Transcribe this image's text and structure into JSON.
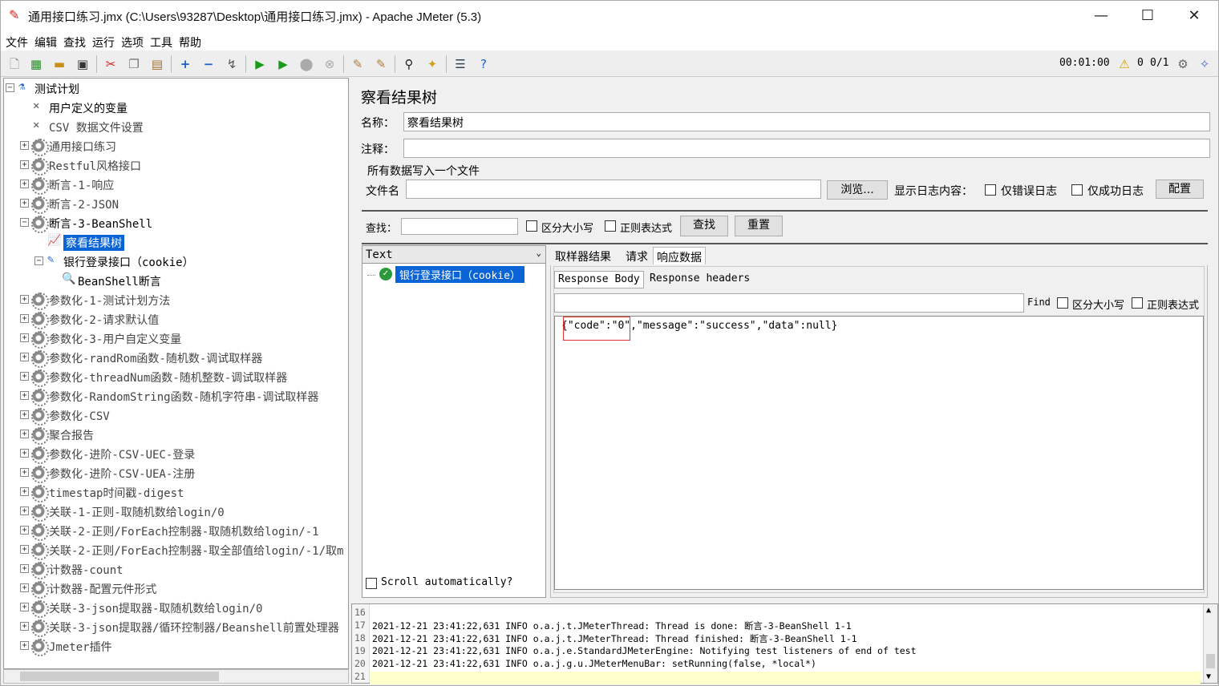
{
  "window": {
    "title": "通用接口练习.jmx (C:\\Users\\93287\\Desktop\\通用接口练习.jmx) - Apache JMeter (5.3)",
    "minimize": "—",
    "maximize": "☐",
    "close": "✕"
  },
  "menu": [
    "文件",
    "编辑",
    "查找",
    "运行",
    "选项",
    "工具",
    "帮助"
  ],
  "toolbar_status": {
    "elapsed": "00:01:00",
    "warnings": "0",
    "threads": "0/1"
  },
  "tree": [
    {
      "label": "测试计划",
      "level": 0,
      "expander": "−",
      "icon": "test-plan-icon"
    },
    {
      "label": "用户定义的变量",
      "level": 1,
      "icon": "wrench-icon"
    },
    {
      "label": "CSV 数据文件设置",
      "level": 1,
      "icon": "wrench-icon"
    },
    {
      "label": "通用接口练习",
      "level": 1,
      "expander": "+",
      "icon": "thread-group-icon"
    },
    {
      "label": "Restful风格接口",
      "level": 1,
      "expander": "+",
      "icon": "thread-group-icon"
    },
    {
      "label": "断言-1-响应",
      "level": 1,
      "expander": "+",
      "icon": "thread-group-icon"
    },
    {
      "label": "断言-2-JSON",
      "level": 1,
      "expander": "+",
      "icon": "thread-group-icon"
    },
    {
      "label": "断言-3-BeanShell",
      "level": 1,
      "expander": "−",
      "icon": "thread-group-icon"
    },
    {
      "label": "察看结果树",
      "level": 2,
      "icon": "results-tree-icon",
      "selected": true
    },
    {
      "label": "银行登录接口（cookie）",
      "level": 2,
      "expander": "−",
      "icon": "sampler-icon"
    },
    {
      "label": "BeanShell断言",
      "level": 3,
      "icon": "assertion-icon"
    },
    {
      "label": "参数化-1-测试计划方法",
      "level": 1,
      "expander": "+",
      "icon": "thread-group-icon"
    },
    {
      "label": "参数化-2-请求默认值",
      "level": 1,
      "expander": "+",
      "icon": "thread-group-icon"
    },
    {
      "label": "参数化-3-用户自定义变量",
      "level": 1,
      "expander": "+",
      "icon": "thread-group-icon"
    },
    {
      "label": "参数化-randRom函数-随机数-调试取样器",
      "level": 1,
      "expander": "+",
      "icon": "thread-group-icon"
    },
    {
      "label": "参数化-threadNum函数-随机整数-调试取样器",
      "level": 1,
      "expander": "+",
      "icon": "thread-group-icon"
    },
    {
      "label": "参数化-RandomString函数-随机字符串-调试取样器",
      "level": 1,
      "expander": "+",
      "icon": "thread-group-icon"
    },
    {
      "label": "参数化-CSV",
      "level": 1,
      "expander": "+",
      "icon": "thread-group-icon"
    },
    {
      "label": "聚合报告",
      "level": 1,
      "expander": "+",
      "icon": "thread-group-icon"
    },
    {
      "label": "参数化-进阶-CSV-UEC-登录",
      "level": 1,
      "expander": "+",
      "icon": "thread-group-icon"
    },
    {
      "label": "参数化-进阶-CSV-UEA-注册",
      "level": 1,
      "expander": "+",
      "icon": "thread-group-icon"
    },
    {
      "label": "timestap时间戳-digest",
      "level": 1,
      "expander": "+",
      "icon": "thread-group-icon"
    },
    {
      "label": "关联-1-正则-取随机数给login/0",
      "level": 1,
      "expander": "+",
      "icon": "thread-group-icon"
    },
    {
      "label": "关联-2-正则/ForEach控制器-取随机数给login/-1",
      "level": 1,
      "expander": "+",
      "icon": "thread-group-icon"
    },
    {
      "label": "关联-2-正则/ForEach控制器-取全部值给login/-1/取m",
      "level": 1,
      "expander": "+",
      "icon": "thread-group-icon"
    },
    {
      "label": "计数器-count",
      "level": 1,
      "expander": "+",
      "icon": "thread-group-icon"
    },
    {
      "label": "计数器-配置元件形式",
      "level": 1,
      "expander": "+",
      "icon": "thread-group-icon"
    },
    {
      "label": "关联-3-json提取器-取随机数给login/0",
      "level": 1,
      "expander": "+",
      "icon": "thread-group-icon"
    },
    {
      "label": "关联-3-json提取器/循环控制器/Beanshell前置处理器",
      "level": 1,
      "expander": "+",
      "icon": "thread-group-icon"
    },
    {
      "label": "Jmeter插件",
      "level": 1,
      "expander": "+",
      "icon": "thread-group-icon"
    }
  ],
  "panel": {
    "title": "察看结果树",
    "name_label": "名称：",
    "name_value": "察看结果树",
    "comment_label": "注释：",
    "comment_value": "",
    "file_section": "所有数据写入一个文件",
    "file_label": "文件名",
    "file_value": "",
    "browse": "浏览...",
    "log_label": "显示日志内容：",
    "errors_only": "仅错误日志",
    "success_only": "仅成功日志",
    "configure": "配置",
    "search_label": "查找：",
    "case_sensitive": "区分大小写",
    "regex": "正则表达式",
    "search_btn": "查找",
    "reset_btn": "重置"
  },
  "results": {
    "renderer": "Text",
    "sample": "银行登录接口（cookie）",
    "scroll_auto": "Scroll automatically?",
    "tabs": [
      "取样器结果",
      "请求",
      "响应数据"
    ],
    "subtabs": [
      "Response Body",
      "Response headers"
    ],
    "find_label": "Find",
    "find_case": "区分大小写",
    "find_regex": "正则表达式",
    "body": "{\"code\":\"0\",\"message\":\"success\",\"data\":null}"
  },
  "log": [
    {
      "n": "16",
      "text": ""
    },
    {
      "n": "17",
      "text": "2021-12-21 23:41:22,631 INFO o.a.j.t.JMeterThread: Thread is done: 断言-3-BeanShell 1-1"
    },
    {
      "n": "18",
      "text": "2021-12-21 23:41:22,631 INFO o.a.j.t.JMeterThread: Thread finished: 断言-3-BeanShell 1-1"
    },
    {
      "n": "19",
      "text": "2021-12-21 23:41:22,631 INFO o.a.j.e.StandardJMeterEngine: Notifying test listeners of end of test"
    },
    {
      "n": "20",
      "text": "2021-12-21 23:41:22,631 INFO o.a.j.g.u.JMeterMenuBar: setRunning(false, *local*)"
    },
    {
      "n": "21",
      "text": ""
    }
  ]
}
